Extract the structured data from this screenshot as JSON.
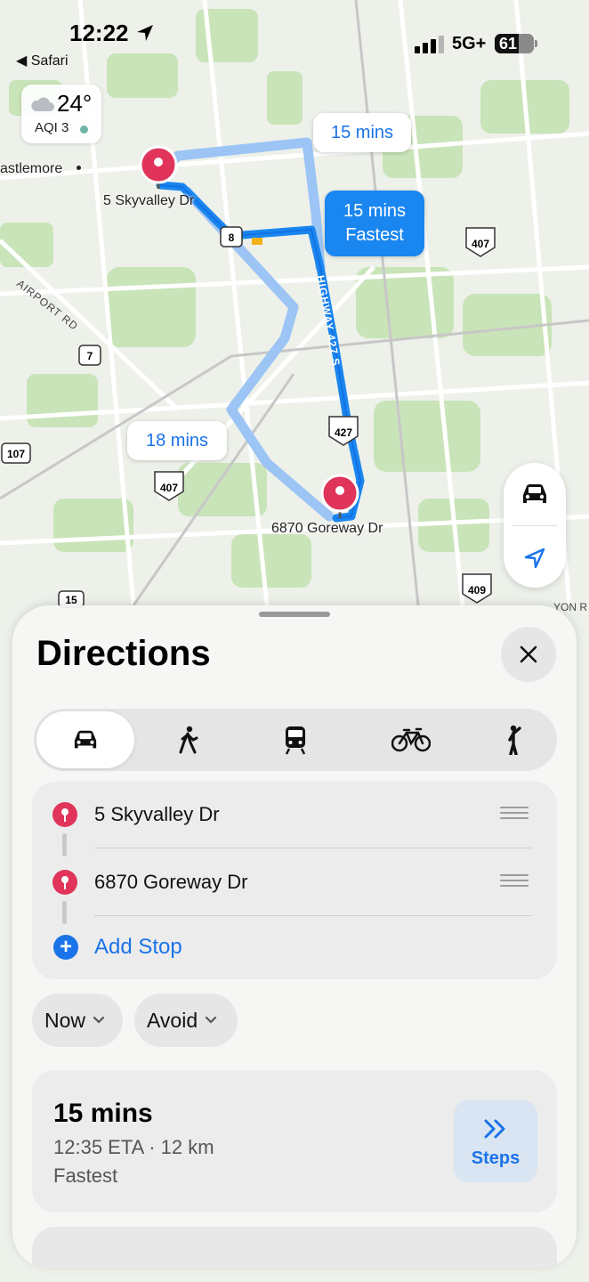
{
  "status_bar": {
    "time": "12:22",
    "back_app": "◀ Safari",
    "network": "5G+",
    "battery": "61"
  },
  "weather": {
    "temp": "24°",
    "aqi": "AQI 3"
  },
  "map": {
    "origin_label": "5 Skyvalley Dr",
    "destination_label": "6870 Goreway Dr",
    "place_label": "astlemore",
    "road_label": "AIRPORT RD",
    "highway_label": "HIGHWAY 427 S",
    "shields": [
      "8",
      "7",
      "107",
      "15",
      "407",
      "407",
      "427",
      "409"
    ],
    "edge_label_right": "YON R",
    "route_bubbles": [
      {
        "time": "15 mins",
        "tag": ""
      },
      {
        "time": "15 mins",
        "tag": "Fastest"
      },
      {
        "time": "18 mins",
        "tag": ""
      }
    ]
  },
  "sheet": {
    "title": "Directions",
    "transport_modes": [
      "drive",
      "walk",
      "transit",
      "cycle",
      "rideshare"
    ],
    "selected_mode": "drive",
    "stops": [
      "5 Skyvalley Dr",
      "6870 Goreway Dr"
    ],
    "add_stop": "Add Stop",
    "time_option": "Now",
    "avoid_option": "Avoid",
    "route": {
      "duration": "15 mins",
      "eta": "12:35 ETA · 12 km",
      "tag": "Fastest",
      "steps_label": "Steps"
    }
  },
  "colors": {
    "accent": "#1a73e8",
    "route": "#1a86f0",
    "pin": "#e0345a"
  }
}
